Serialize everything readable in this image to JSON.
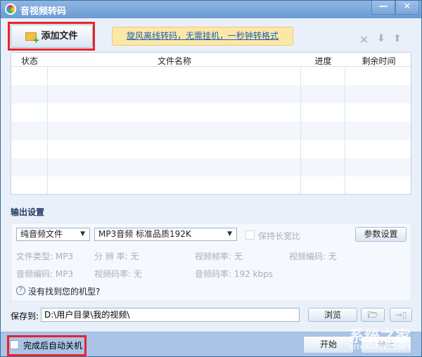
{
  "window": {
    "title": "音视频转码",
    "minimize": "—",
    "close": "✕"
  },
  "toolbar": {
    "add_file": "添加文件",
    "promo_link": "旋风离线转码，无需挂机，一秒钟转格式",
    "icons": [
      "delete-icon",
      "move-down-icon",
      "move-up-icon"
    ]
  },
  "table": {
    "columns": [
      "状态",
      "文件名称",
      "进度",
      "剩余时间"
    ],
    "rows": []
  },
  "output": {
    "heading": "输出设置",
    "category": "纯音频文件",
    "preset": "MP3音频 标准品质192K",
    "keep_ratio": "保持长宽比",
    "params_button": "参数设置",
    "info": [
      {
        "label": "文件类型:",
        "value": "MP3"
      },
      {
        "label": "分 辨 率:",
        "value": "无"
      },
      {
        "label": "视频帧率:",
        "value": "无"
      },
      {
        "label": "视频编码:",
        "value": "无"
      },
      {
        "label": "音频编码:",
        "value": "MP3"
      },
      {
        "label": "视频码率:",
        "value": "无"
      },
      {
        "label": "音频码率:",
        "value": "192 kbps"
      }
    ],
    "help": "没有找到您的机型?"
  },
  "save": {
    "label": "保存到:",
    "path": "D:\\用户目录\\我的视频\\",
    "browse": "浏览"
  },
  "footer": {
    "auto_shutdown": "完成后自动关机",
    "start": "开始",
    "stop": "停止"
  },
  "watermark": {
    "text": "系统之家",
    "url": "XITONGZHIJIA.NET"
  },
  "colors": {
    "title_bar": "#7aa6da",
    "highlight": "#e8232b",
    "promo_bg": "#fde7a6",
    "link": "#1a5fb4"
  }
}
